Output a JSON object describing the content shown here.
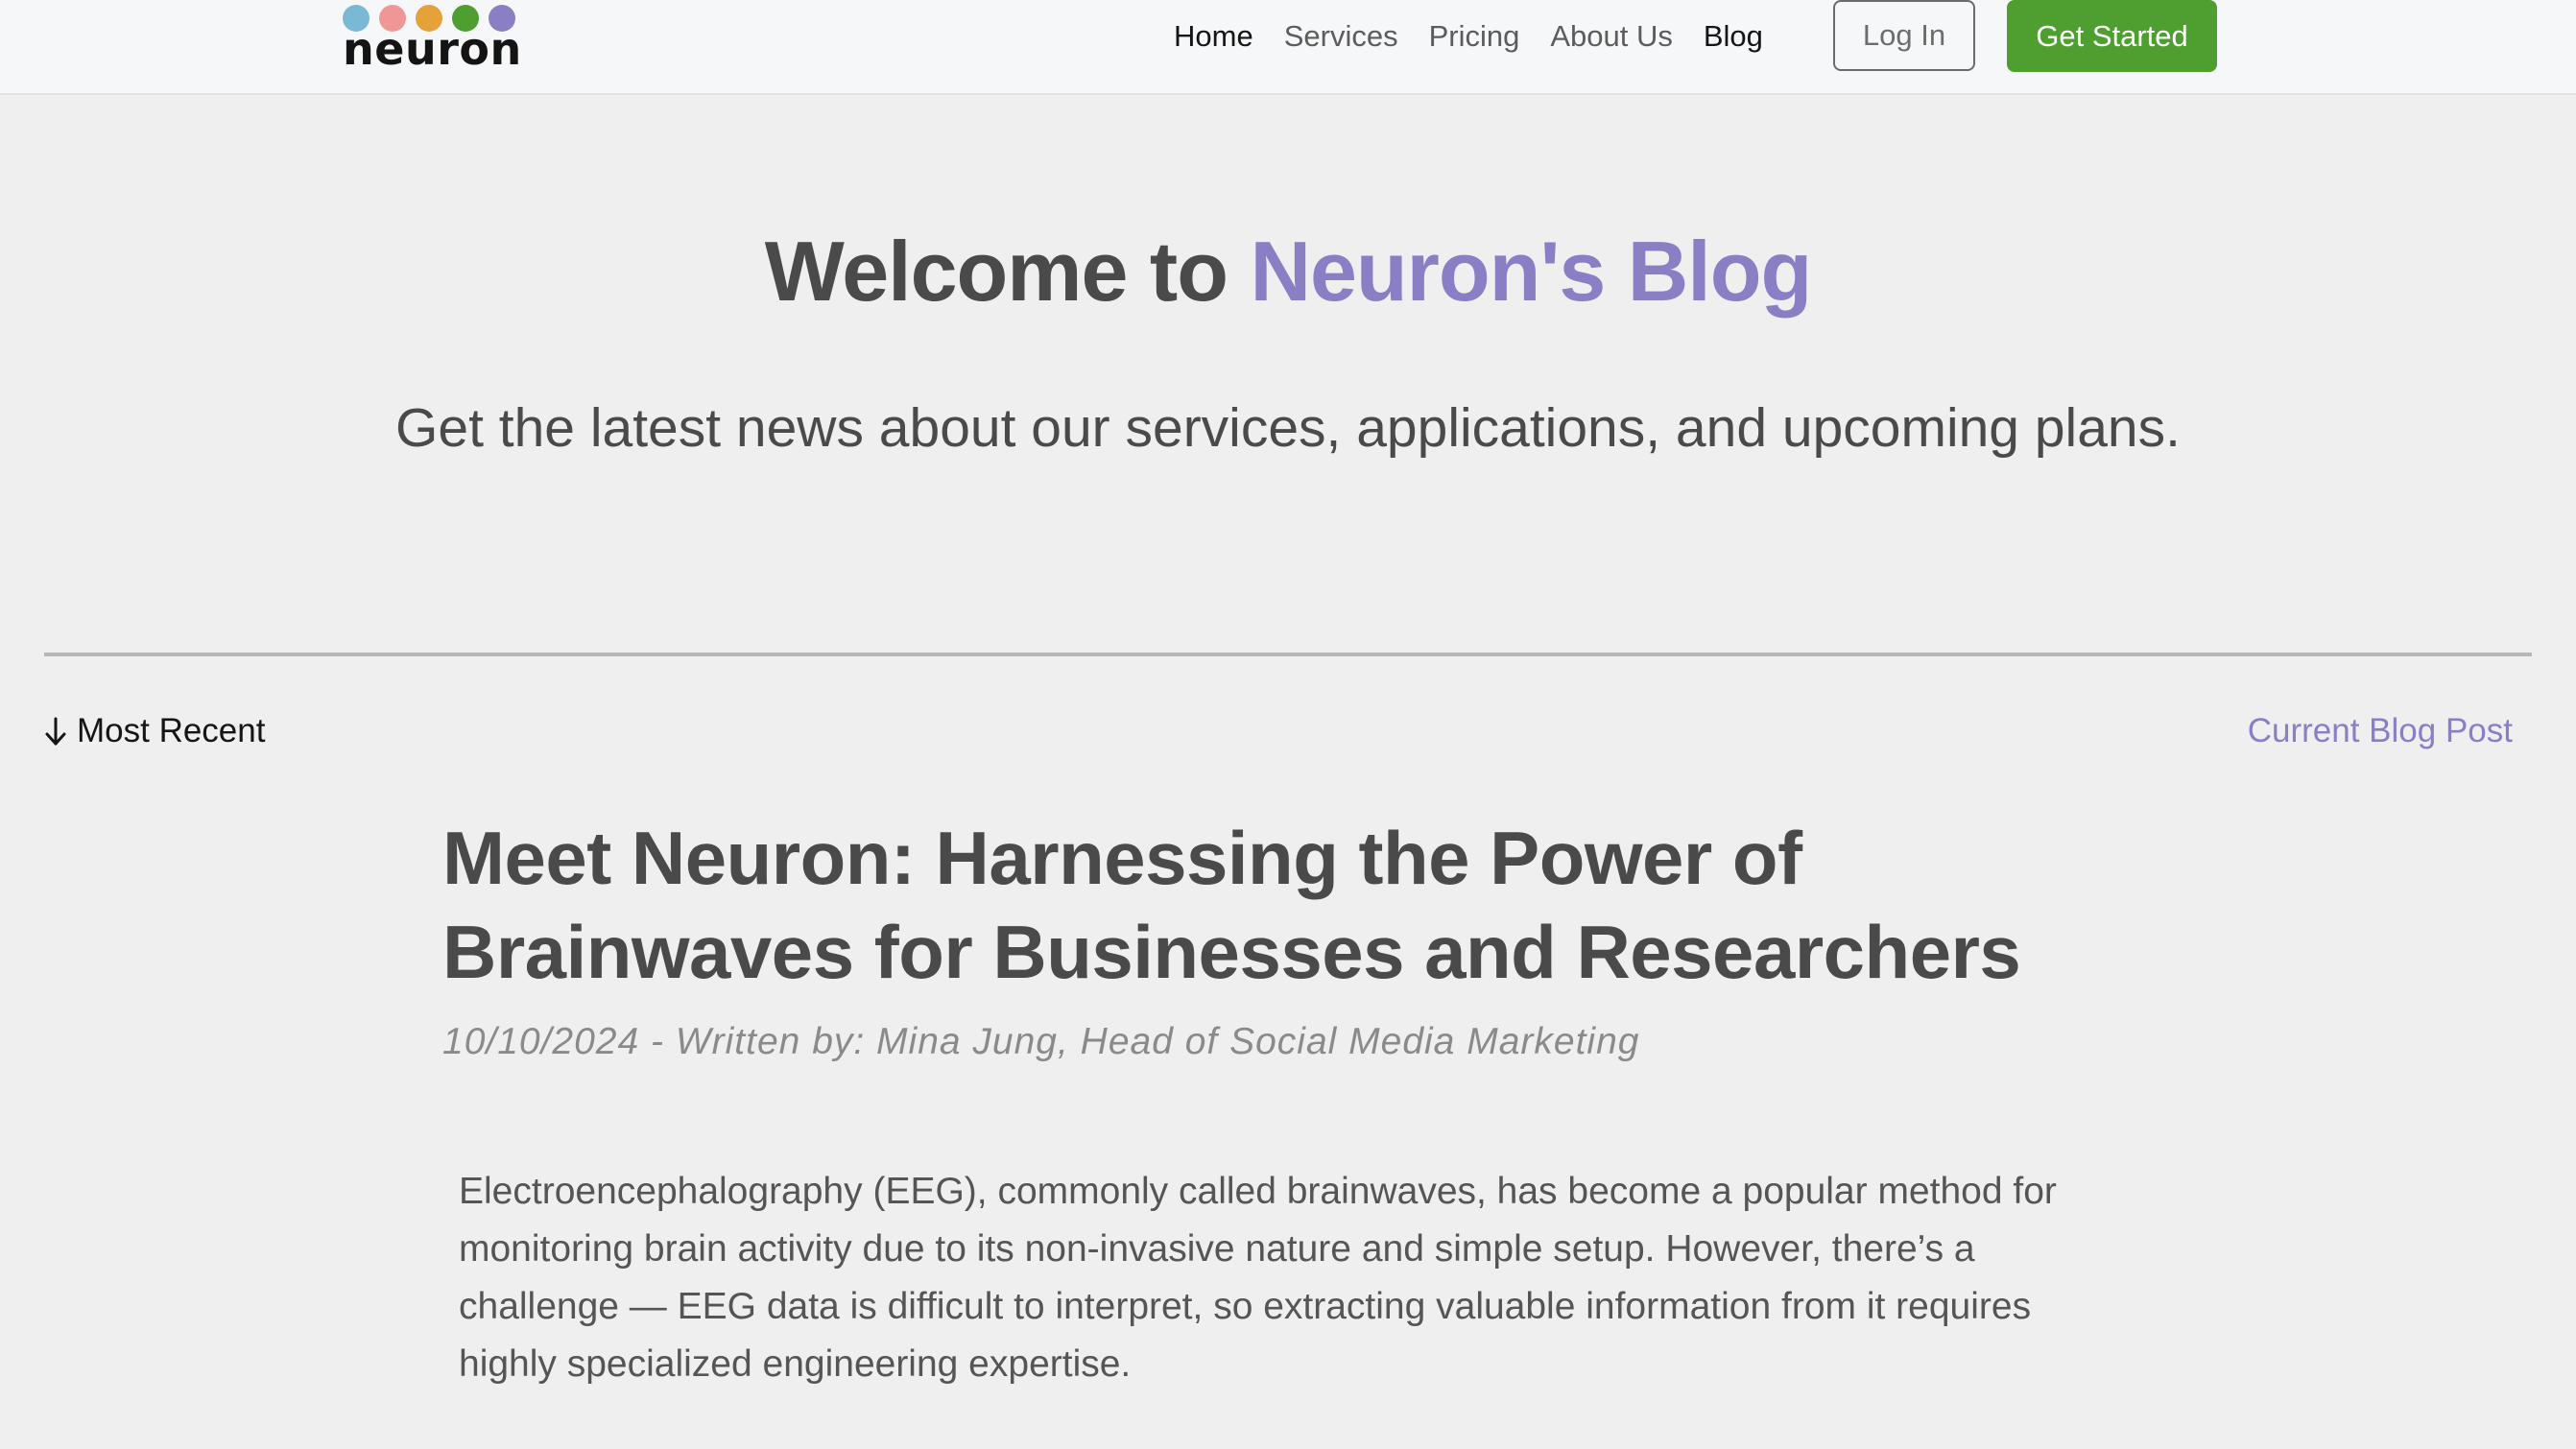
{
  "brand": {
    "name": "neuron",
    "dot_colors": [
      "#7ab8d6",
      "#ef9797",
      "#e6a23a",
      "#4f9e30",
      "#8a7fc4"
    ]
  },
  "nav": {
    "items": [
      {
        "label": "Home",
        "active": false
      },
      {
        "label": "Services",
        "active": false
      },
      {
        "label": "Pricing",
        "active": false
      },
      {
        "label": "About Us",
        "active": false
      },
      {
        "label": "Blog",
        "active": true
      }
    ],
    "login_label": "Log In",
    "cta_label": "Get Started"
  },
  "hero": {
    "title_prefix": "Welcome to ",
    "title_accent": "Neuron's Blog",
    "subtitle": "Get the latest news about our services, applications, and upcoming plans."
  },
  "section": {
    "left_label": "Most Recent",
    "left_icon": "arrow-down-icon",
    "right_link": "Current Blog Post"
  },
  "post": {
    "title": "Meet Neuron: Harnessing the Power of Brainwaves for Businesses and Researchers",
    "meta": "10/10/2024 - Written by: Mina Jung, Head of Social Media Marketing",
    "body": "Electroencephalography (EEG), commonly called brainwaves, has become a popular method for monitoring brain activity due to its non-invasive nature and simple setup. However, there’s a challenge — EEG data is difficult to interpret, so extracting valuable information from it requires highly specialized engineering expertise."
  },
  "colors": {
    "accent_purple": "#8a7fc4",
    "cta_green": "#4f9e30",
    "background": "#efefef",
    "header_bg": "#f6f7f9"
  }
}
